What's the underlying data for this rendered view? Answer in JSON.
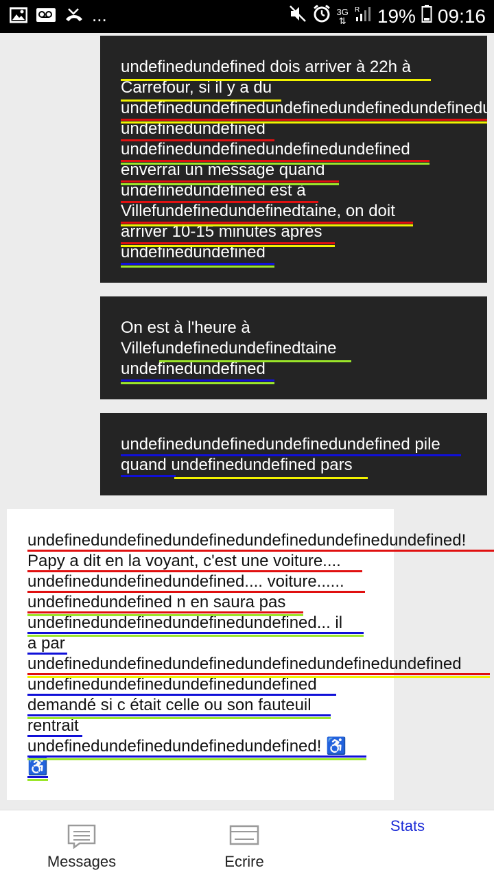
{
  "status_bar": {
    "left_icons": [
      "image-icon",
      "voicemail-icon",
      "missed-call-icon"
    ],
    "more": "...",
    "battery_percent": "19%",
    "time": "09:16",
    "network": "3G"
  },
  "messages": [
    {
      "side": "sent",
      "lines": [
        "undefinedundefined dois arriver à 22h à",
        "Carrefour, si il y a du",
        "undefinedundefinedundefinedundefinedundefinedundefined",
        "undefinedundefined",
        "undefinedundefinedundefinedundefined",
        "enverrai un message quand",
        "undefinedundefined est à",
        "Villefundefinedundefinedtaine, on doit",
        "arriver 10-15 minutes après",
        "undefinedundefined"
      ]
    },
    {
      "side": "sent",
      "lines": [
        "On est à l'heure à",
        "Villefundefinedundefinedtaine",
        "undefinedundefined"
      ]
    },
    {
      "side": "sent",
      "lines": [
        "undefinedundefinedundefinedundefined pile",
        "quand undefinedundefined pars"
      ]
    },
    {
      "side": "received",
      "lines": [
        "undefinedundefinedundefinedundefinedundefinedundefined!",
        "Papy a dit en la voyant, c'est une voiture....",
        "undefinedundefinedundefined.... voiture......",
        "undefinedundefined n en saura pas",
        "undefinedundefinedundefinedundefined... il",
        "a par",
        "undefinedundefinedundefinedundefinedundefinedundefined",
        "undefinedundefinedundefinedundefined",
        "demandé si c était celle ou son fauteuil",
        "rentrait",
        "undefinedundefinedundefinedundefined! ♿",
        "♿"
      ]
    }
  ],
  "bottom_nav": {
    "messages_label": "Messages",
    "write_label": "Ecrire",
    "stats_label": "Stats"
  },
  "colors": {
    "red": "#e01010",
    "yellow": "#f2f200",
    "green": "#9be62a",
    "blue": "#1010d8",
    "accent": "#1b2bd6"
  }
}
